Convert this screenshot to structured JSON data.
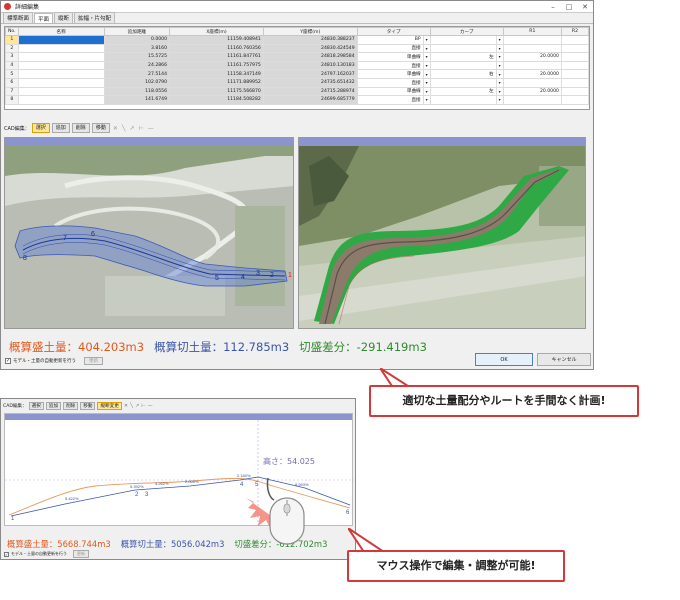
{
  "window": {
    "title": "詳細編集",
    "tabs": [
      "標準断面",
      "平面",
      "縦断",
      "拡幅・片勾配"
    ],
    "columns": [
      "No.",
      "名称",
      "追加距離",
      "X座標(m)",
      "Y座標(m)",
      "タイプ",
      "カーブ",
      "R1",
      "R2"
    ],
    "rows": [
      {
        "no": "1",
        "name": "",
        "dist": "0.0000",
        "x": "11159.408941",
        "y": "24830.388237",
        "type": "BP",
        "curve": "",
        "r1": ""
      },
      {
        "no": "2",
        "name": "",
        "dist": "3.8160",
        "x": "11160.760356",
        "y": "24830.424549",
        "type": "直接",
        "curve": "",
        "r1": ""
      },
      {
        "no": "3",
        "name": "",
        "dist": "15.5725",
        "x": "11161.847761",
        "y": "24818.298584",
        "type": "単曲線",
        "curve": "左",
        "r1": "20.0000"
      },
      {
        "no": "4",
        "name": "",
        "dist": "24.2866",
        "x": "11161.757975",
        "y": "24810.130183",
        "type": "直接",
        "curve": "",
        "r1": ""
      },
      {
        "no": "5",
        "name": "",
        "dist": "27.5144",
        "x": "11158.347149",
        "y": "24797.162037",
        "type": "単曲線",
        "curve": "右",
        "r1": "20.0000"
      },
      {
        "no": "6",
        "name": "",
        "dist": "102.0790",
        "x": "11171.889952",
        "y": "24735.651432",
        "type": "直接",
        "curve": "",
        "r1": ""
      },
      {
        "no": "7",
        "name": "",
        "dist": "118.0556",
        "x": "11175.566870",
        "y": "24715.288974",
        "type": "単曲線",
        "curve": "左",
        "r1": "20.0000"
      },
      {
        "no": "8",
        "name": "",
        "dist": "141.6749",
        "x": "11184.508282",
        "y": "24699.685779",
        "type": "直接",
        "curve": "",
        "r1": ""
      }
    ],
    "cad_label": "CAD編集：",
    "cad_buttons": [
      "選択",
      "追加",
      "削除",
      "移動"
    ],
    "plan_labels": [
      "1",
      "2",
      "3",
      "4",
      "5",
      "6",
      "7",
      "8"
    ],
    "summary": {
      "fill": "概算盛土量：404.203m3",
      "cut": "概算切土量：112.785m3",
      "diff": "切盛差分：-291.419m3"
    },
    "checkbox_label": "モデル・土量の自動更新を行う",
    "update_button": "更新",
    "ok_button": "OK",
    "cancel_button": "キャンセル"
  },
  "profile_window": {
    "cad_label": "CAD編集：",
    "cad_buttons": [
      "選択",
      "追加",
      "削除",
      "移動",
      "縦断変更"
    ],
    "height_label": "高さ：54.025",
    "grade_labels": [
      "5.422%",
      "5.392%",
      "3.262%",
      "2.000%",
      "2.180%",
      "8.593%"
    ],
    "point_labels": [
      "1",
      "2",
      "3",
      "4",
      "5",
      "6"
    ],
    "summary": {
      "fill": "概算盛土量：5668.744m3",
      "cut": "概算切土量：5056.042m3",
      "diff": "切盛差分：-612.702m3"
    },
    "checkbox_label": "モデル・土量の自動更新を行う",
    "update_button": "更新"
  },
  "callouts": {
    "plan": "適切な土量配分やルートを手間なく計画!",
    "edit": "マウス操作で編集・調整が可能!"
  }
}
